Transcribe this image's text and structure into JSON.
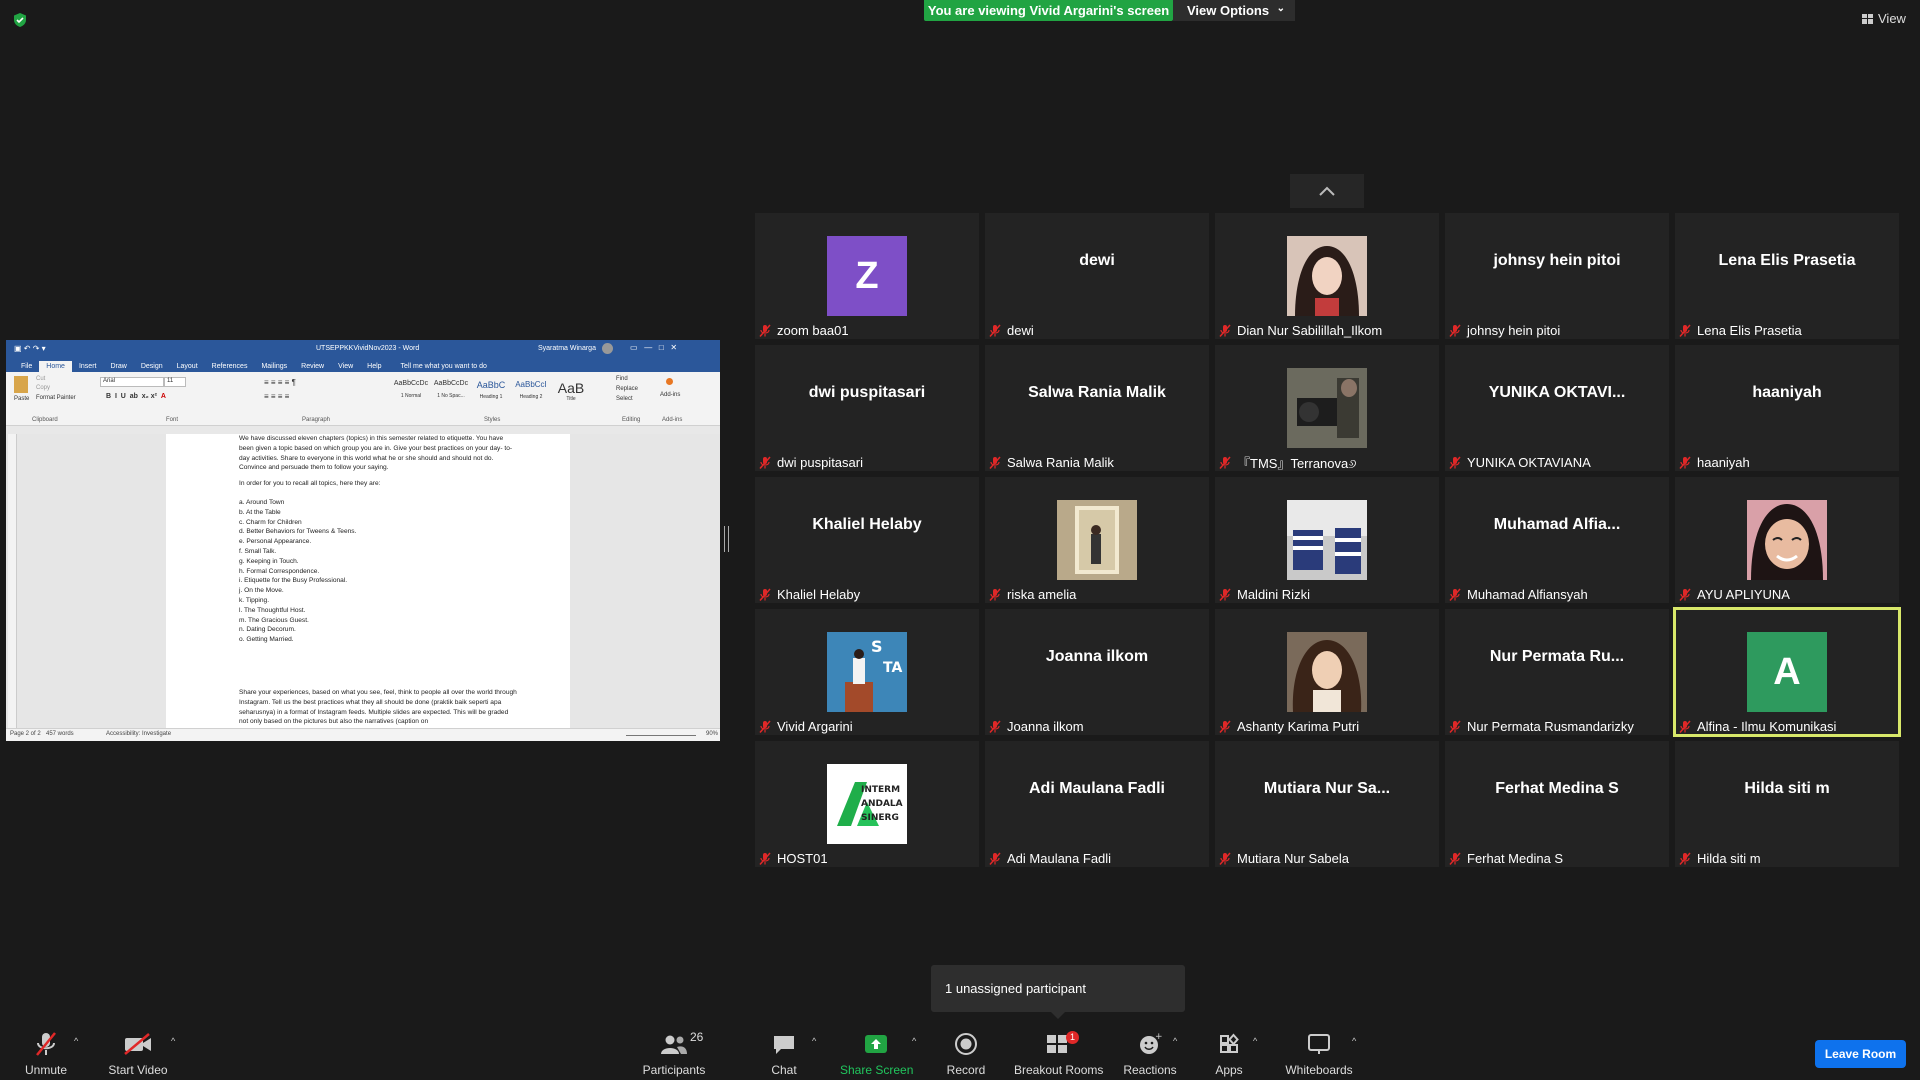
{
  "top": {
    "viewing_banner": "You are viewing Vivid Argarini's screen",
    "view_options": "View Options",
    "view_label": "View"
  },
  "word": {
    "title": "UTSEPPKKVividNov2023 - Word",
    "user": "Syaratma Winarga",
    "tabs": [
      "File",
      "Home",
      "Insert",
      "Draw",
      "Design",
      "Layout",
      "References",
      "Mailings",
      "Review",
      "View",
      "Help"
    ],
    "tell_me": "Tell me what you want to do",
    "ribbon": {
      "clipboard": "Clipboard",
      "font": "Font",
      "paragraph": "Paragraph",
      "styles": "Styles",
      "editing": "Editing",
      "addins": "Add-ins",
      "paste": "Paste",
      "cut": "Cut",
      "copy": "Copy",
      "format_painter": "Format Painter",
      "font_name": "Arial",
      "font_size": "11",
      "find": "Find",
      "replace": "Replace",
      "select": "Select",
      "style_items": [
        {
          "preview": "AaBbCcDc",
          "name": "1 Normal"
        },
        {
          "preview": "AaBbCcDc",
          "name": "1 No Spac..."
        },
        {
          "preview": "AaBbC",
          "name": "Heading 1"
        },
        {
          "preview": "AaBbCcI",
          "name": "Heading 2"
        },
        {
          "preview": "AaB",
          "name": "Title"
        }
      ]
    },
    "doc": {
      "p1": "We have discussed eleven chapters (topics) in this semester related to etiquette. You have been given a topic based on which group you are in. Give your best practices on your day- to- day activities. Share to everyone in this world what he or she should and should not do. Convince and persuade them to follow your saying.",
      "p2": "In order for you to recall all topics, here they are:",
      "topics": [
        "a. Around Town",
        "b. At the Table",
        "c. Charm for Children",
        "d. Better Behaviors for Tweens & Teens.",
        "e. Personal Appearance.",
        "f.  Small Talk.",
        "g. Keeping in Touch.",
        "h. Formal Correspondence.",
        "i.  Etiquette for the Busy Professional.",
        "j.  On the Move.",
        "k. Tipping.",
        "l. The Thoughtful Host.",
        "m. The Gracious Guest.",
        "n. Dating Decorum.",
        "o. Getting Married."
      ],
      "p3": "Share your experiences, based on what you see, feel, think to people all over the world through Instagram. Tell us the best practices what they all should be done (praktik baik seperti apa seharusnya) in a format of Instagram feeds. Multiple slides are expected. This will be graded not only based on the pictures but also the narratives (caption on"
    },
    "status": {
      "page": "Page 2 of 2",
      "words": "457 words",
      "accessibility": "Accessibility: Investigate",
      "zoom": "90%"
    }
  },
  "participants": [
    {
      "name": "zoom baa01",
      "big": "",
      "avatar_letter": "Z",
      "avatar_color": "#7e4fc7",
      "photo": ""
    },
    {
      "name": "dewi",
      "big": "dewi",
      "avatar_letter": "",
      "avatar_color": "",
      "photo": ""
    },
    {
      "name": "Dian Nur Sabilillah_Ilkom",
      "big": "",
      "avatar_letter": "",
      "avatar_color": "",
      "photo": "portrait"
    },
    {
      "name": "johnsy hein pitoi",
      "big": "johnsy hein pitoi",
      "avatar_letter": "",
      "avatar_color": "",
      "photo": ""
    },
    {
      "name": "Lena Elis Prasetia",
      "big": "Lena Elis Prasetia",
      "avatar_letter": "",
      "avatar_color": "",
      "photo": ""
    },
    {
      "name": "dwi puspitasari",
      "big": "dwi puspitasari",
      "avatar_letter": "",
      "avatar_color": "",
      "photo": ""
    },
    {
      "name": "Salwa Rania Malik",
      "big": "Salwa Rania Malik",
      "avatar_letter": "",
      "avatar_color": "",
      "photo": ""
    },
    {
      "name": "『TMS』Terranova୬",
      "big": "",
      "avatar_letter": "",
      "avatar_color": "",
      "photo": "camera"
    },
    {
      "name": "YUNIKA OKTAVIANA",
      "big": "YUNIKA  OKTAVI...",
      "avatar_letter": "",
      "avatar_color": "",
      "photo": ""
    },
    {
      "name": "haaniyah",
      "big": "haaniyah",
      "avatar_letter": "",
      "avatar_color": "",
      "photo": ""
    },
    {
      "name": "Khaliel Helaby",
      "big": "Khaliel Helaby",
      "avatar_letter": "",
      "avatar_color": "",
      "photo": ""
    },
    {
      "name": "riska amelia",
      "big": "",
      "avatar_letter": "",
      "avatar_color": "",
      "photo": "mirror"
    },
    {
      "name": "Maldini Rizki",
      "big": "",
      "avatar_letter": "",
      "avatar_color": "",
      "photo": "stripes"
    },
    {
      "name": "Muhamad Alfiansyah",
      "big": "Muhamad  Alfia...",
      "avatar_letter": "",
      "avatar_color": "",
      "photo": ""
    },
    {
      "name": "AYU APLIYUNA",
      "big": "",
      "avatar_letter": "",
      "avatar_color": "",
      "photo": "face"
    },
    {
      "name": "Vivid Argarini",
      "big": "",
      "avatar_letter": "",
      "avatar_color": "",
      "photo": "stage"
    },
    {
      "name": "Joanna ilkom",
      "big": "Joanna ilkom",
      "avatar_letter": "",
      "avatar_color": "",
      "photo": ""
    },
    {
      "name": "Ashanty Karima Putri",
      "big": "",
      "avatar_letter": "",
      "avatar_color": "",
      "photo": "portrait2"
    },
    {
      "name": "Nur Permata Rusmandarizky",
      "big": "Nur Permata Ru...",
      "avatar_letter": "",
      "avatar_color": "",
      "photo": ""
    },
    {
      "name": "Alfina - Ilmu Komunikasi",
      "big": "",
      "avatar_letter": "A",
      "avatar_color": "#2e9a5e",
      "photo": "",
      "active": true
    },
    {
      "name": "HOST01",
      "big": "",
      "avatar_letter": "",
      "avatar_color": "",
      "photo": "logo"
    },
    {
      "name": "Adi Maulana Fadli",
      "big": "Adi Maulana Fadli",
      "avatar_letter": "",
      "avatar_color": "",
      "photo": ""
    },
    {
      "name": "Mutiara Nur Sabela",
      "big": "Mutiara  Nur  Sa...",
      "avatar_letter": "",
      "avatar_color": "",
      "photo": ""
    },
    {
      "name": "Ferhat Medina S",
      "big": "Ferhat Medina S",
      "avatar_letter": "",
      "avatar_color": "",
      "photo": ""
    },
    {
      "name": "Hilda siti m",
      "big": "Hilda siti m",
      "avatar_letter": "",
      "avatar_color": "",
      "photo": ""
    }
  ],
  "host_logo_text": [
    "INTERM",
    "ANDALA",
    "SINERG"
  ],
  "tooltip": "1 unassigned participant",
  "toolbar": {
    "unmute": "Unmute",
    "start_video": "Start Video",
    "participants": "Participants",
    "participants_count": "26",
    "chat": "Chat",
    "share_screen": "Share Screen",
    "record": "Record",
    "breakout_rooms": "Breakout Rooms",
    "breakout_badge": "1",
    "reactions": "Reactions",
    "apps": "Apps",
    "whiteboards": "Whiteboards",
    "leave_room": "Leave Room"
  },
  "colors": {
    "share_green": "#21a443",
    "leave_blue": "#0e72ed",
    "active_speaker": "#d8e86a",
    "muted_red": "#e02828"
  }
}
